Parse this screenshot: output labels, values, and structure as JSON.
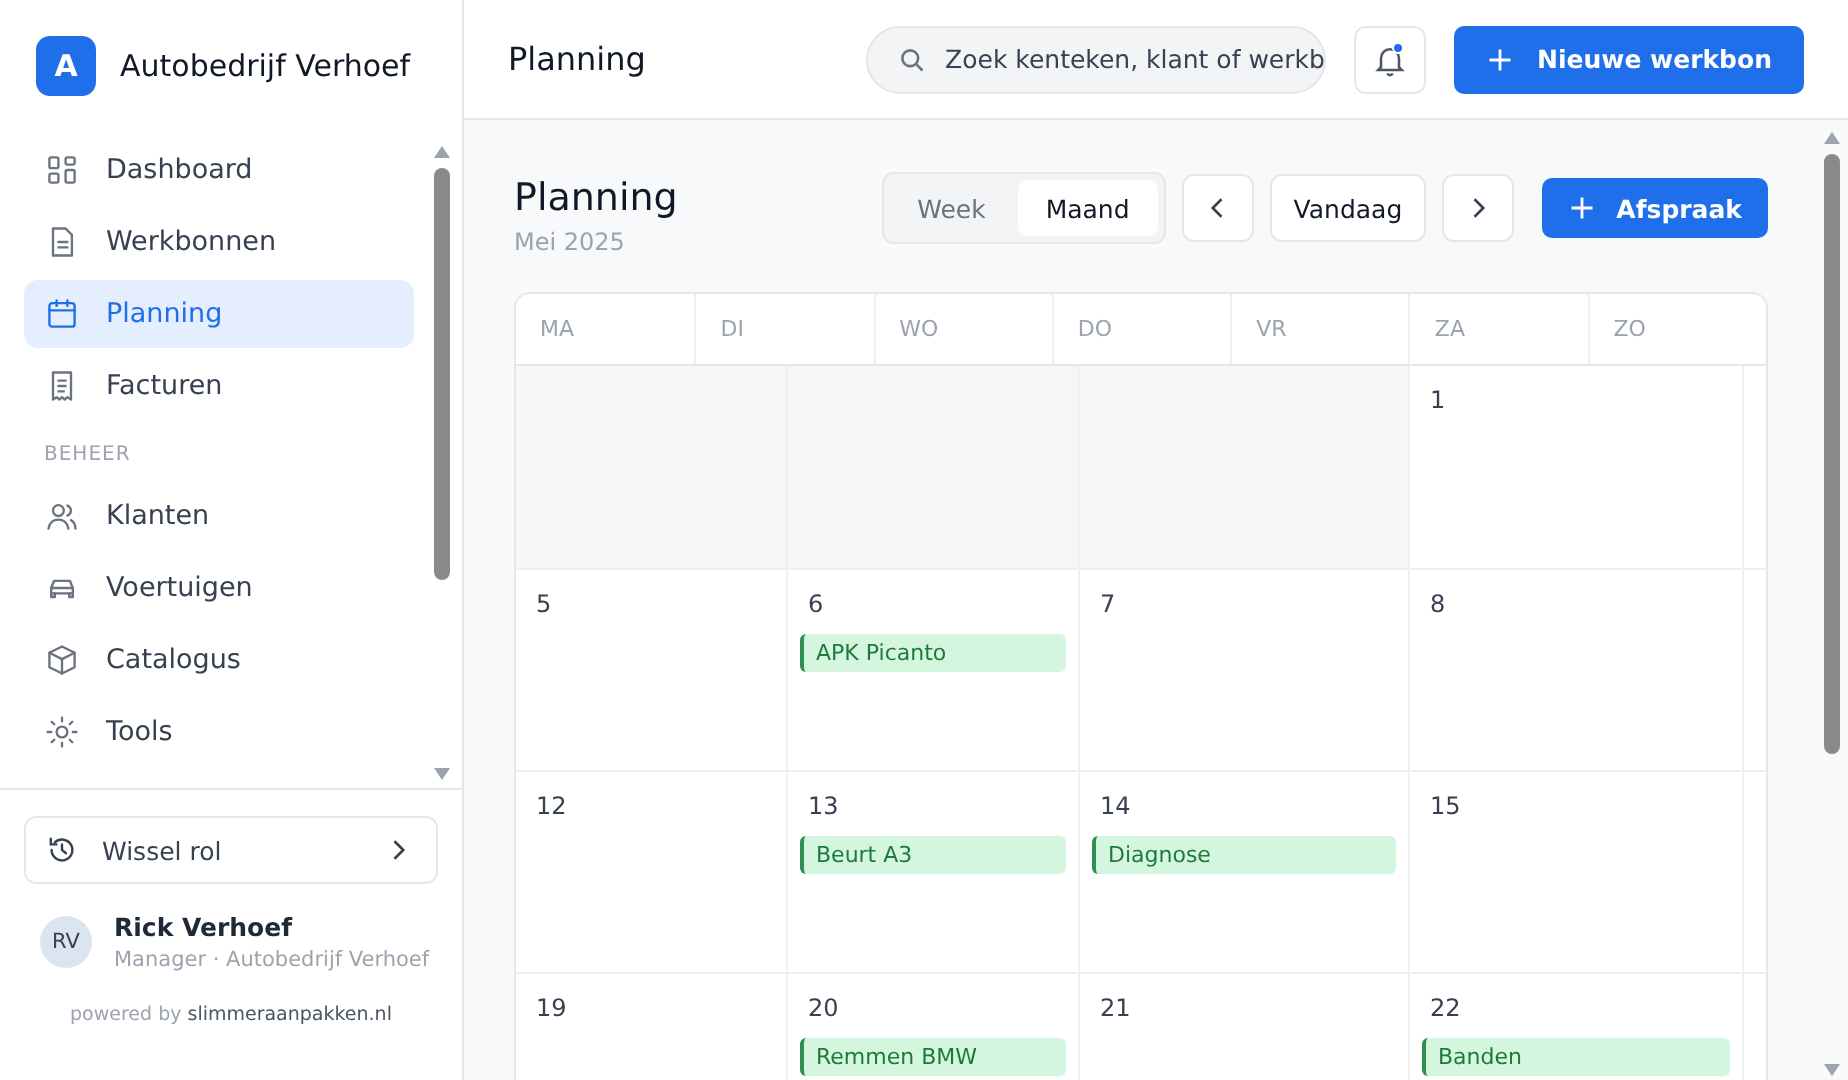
{
  "brand": {
    "logo_letter": "A",
    "name": "Autobedrijf Verhoef"
  },
  "sidebar": {
    "items": [
      {
        "kind": "link",
        "label": "Dashboard",
        "selected": false
      },
      {
        "kind": "link",
        "label": "Werkbonnen",
        "selected": false
      },
      {
        "kind": "link",
        "label": "Planning",
        "selected": true
      },
      {
        "kind": "link",
        "label": "Facturen",
        "selected": false
      },
      {
        "kind": "section",
        "label": "BEHEER"
      },
      {
        "kind": "link",
        "label": "Klanten",
        "selected": false
      },
      {
        "kind": "link",
        "label": "Voertuigen",
        "selected": false
      },
      {
        "kind": "link",
        "label": "Catalogus",
        "selected": false
      },
      {
        "kind": "link",
        "label": "Tools",
        "selected": false
      }
    ],
    "switch_role": "Wissel rol",
    "user": {
      "initials": "RV",
      "name": "Rick Verhoef",
      "role": "Manager · Autobedrijf Verhoef"
    },
    "powered_by": "powered by **slimmeraanpakken.nl**"
  },
  "topbar": {
    "title": "Planning",
    "search": {
      "value": "Zoek kenteken, klant of werkb"
    },
    "notification_dot": true,
    "new_button": "Nieuwe werkbon"
  },
  "page": {
    "title": "Planning",
    "subtitle": "Mei 2025",
    "view_toggle": [
      {
        "label": "Week",
        "selected": false
      },
      {
        "label": "Maand",
        "selected": true
      }
    ],
    "today_button": "Vandaag",
    "add_button": "Afspraak"
  },
  "calendar": {
    "weekdays": [
      "MA",
      "DI",
      "WO",
      "DO",
      "VR",
      "ZA",
      "ZO"
    ],
    "weeks": [
      {
        "days": [
          {
            "kind": "outside"
          },
          {
            "kind": "outside"
          },
          {
            "kind": "outside"
          },
          {
            "kind": "day",
            "date": "1"
          }
        ]
      },
      {
        "days": [
          {
            "kind": "day",
            "date": "5"
          },
          {
            "kind": "day",
            "date": "6",
            "events": [
              "APK Picanto"
            ]
          },
          {
            "kind": "day",
            "date": "7"
          },
          {
            "kind": "day",
            "date": "8"
          }
        ]
      },
      {
        "days": [
          {
            "kind": "day",
            "date": "12"
          },
          {
            "kind": "day",
            "date": "13",
            "events": [
              "Beurt A3"
            ]
          },
          {
            "kind": "day",
            "date": "14",
            "events": [
              "Diagnose"
            ]
          },
          {
            "kind": "day",
            "date": "15"
          }
        ]
      },
      {
        "days": [
          {
            "kind": "day",
            "date": "19"
          },
          {
            "kind": "day",
            "date": "20",
            "events": [
              "Remmen BMW"
            ]
          },
          {
            "kind": "day",
            "date": "21"
          },
          {
            "kind": "day",
            "date": "22",
            "events": [
              "Banden"
            ]
          }
        ]
      }
    ]
  }
}
